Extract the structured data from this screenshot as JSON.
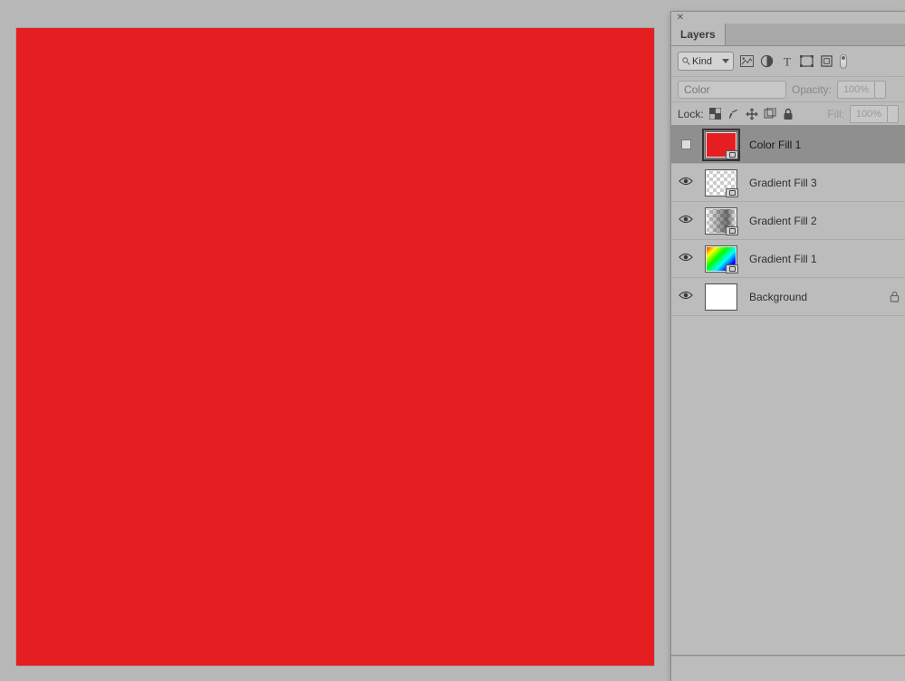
{
  "canvas": {
    "fill": "#e51e22"
  },
  "panel": {
    "tab": "Layers",
    "filter": {
      "kind_label": "Kind",
      "icons": [
        "image",
        "adjust",
        "type",
        "shape",
        "smart",
        "toggle"
      ]
    },
    "blend": {
      "mode": "Color",
      "opacity_label": "Opacity:",
      "opacity_value": "100%"
    },
    "lock": {
      "label": "Lock:",
      "fill_label": "Fill:",
      "fill_value": "100%"
    },
    "layers": [
      {
        "name": "Color Fill 1",
        "visible": false,
        "selected": true,
        "thumb": "red",
        "locked": false
      },
      {
        "name": "Gradient Fill 3",
        "visible": true,
        "selected": false,
        "thumb": "checker",
        "locked": false
      },
      {
        "name": "Gradient Fill 2",
        "visible": true,
        "selected": false,
        "thumb": "grad2",
        "locked": false
      },
      {
        "name": "Gradient Fill 1",
        "visible": true,
        "selected": false,
        "thumb": "rainbow",
        "locked": false
      },
      {
        "name": "Background",
        "visible": true,
        "selected": false,
        "thumb": "white",
        "locked": true
      }
    ]
  }
}
